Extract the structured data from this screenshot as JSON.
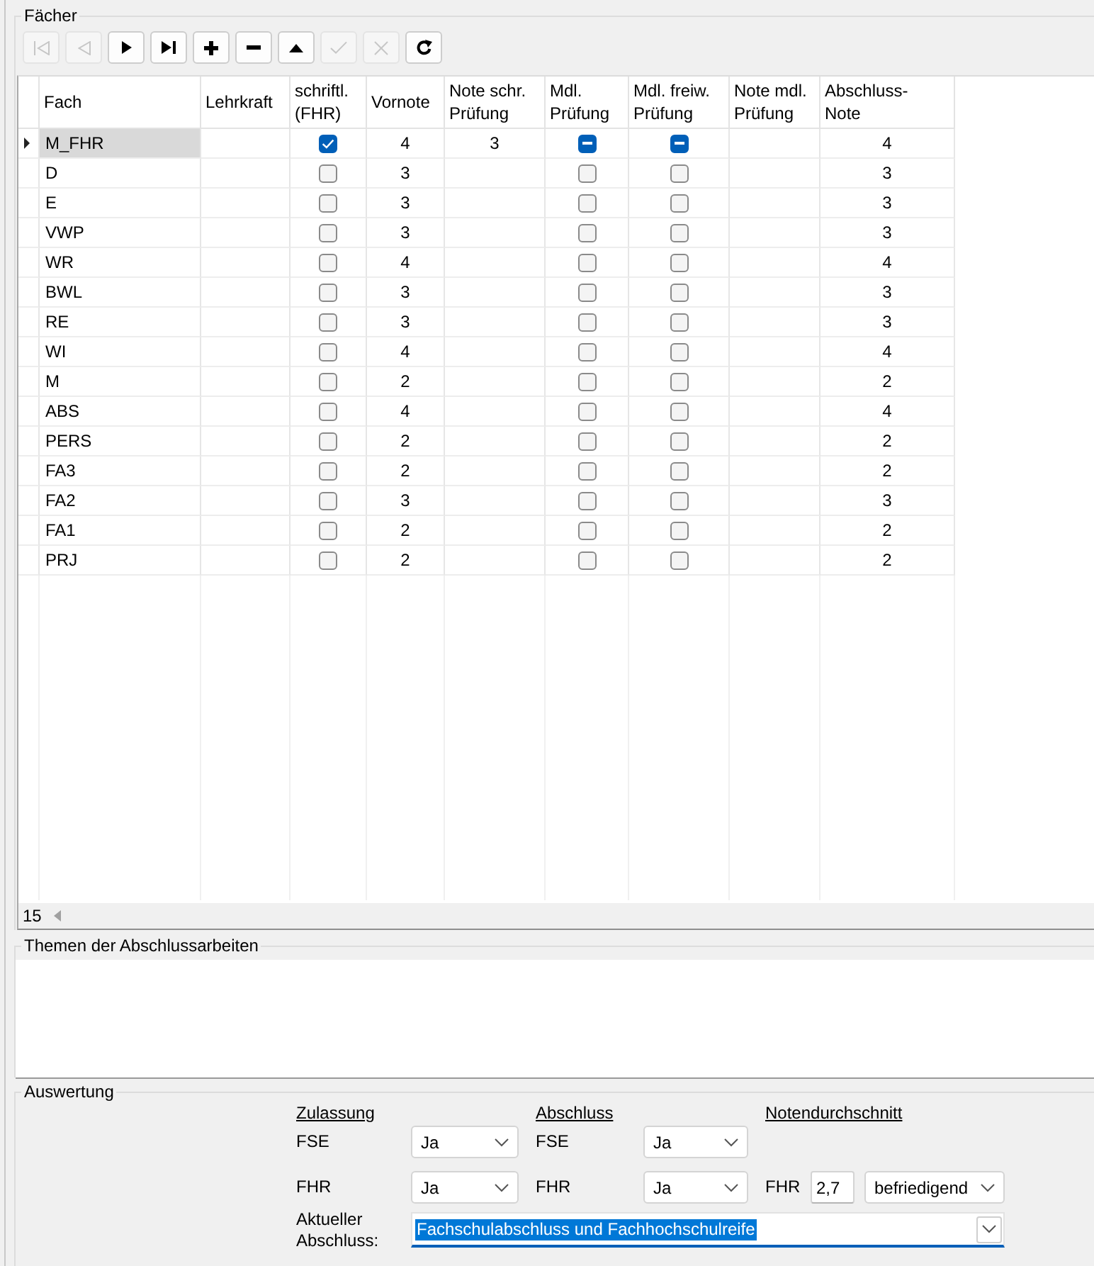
{
  "subjects": {
    "title": "Fächer",
    "toolbar": [
      {
        "kind": "first",
        "disabled": true
      },
      {
        "kind": "prior",
        "disabled": true
      },
      {
        "kind": "next",
        "disabled": false
      },
      {
        "kind": "last",
        "disabled": false
      },
      {
        "kind": "insert",
        "disabled": false
      },
      {
        "kind": "delete",
        "disabled": false
      },
      {
        "kind": "edit",
        "disabled": false
      },
      {
        "kind": "post",
        "disabled": true
      },
      {
        "kind": "cancel",
        "disabled": true
      },
      {
        "kind": "refresh",
        "disabled": false
      }
    ],
    "table": {
      "columns": [
        "Fach",
        "Lehrkraft",
        "schriftl. (FHR)",
        "Vornote",
        "Note schr. Prüfung",
        "Mdl. Prüfung",
        "Mdl. freiw. Prüfung",
        "Note mdl. Prüfung",
        "Abschluss-Note"
      ],
      "rows": [
        {
          "selected": true,
          "fach": "M_FHR",
          "schriftl": {
            "checked": true
          },
          "vornote": "4",
          "note_schr": "3",
          "mdl": {
            "checked": true,
            "indeterminate": true
          },
          "mdl_freiw": {
            "checked": true,
            "indeterminate": true
          },
          "abschluss_note": "4"
        },
        {
          "selected": false,
          "fach": "D",
          "schriftl": {
            "checked": false
          },
          "vornote": "3",
          "mdl": {
            "checked": false
          },
          "mdl_freiw": {
            "checked": false
          },
          "abschluss_note": "3"
        },
        {
          "selected": false,
          "fach": "E",
          "schriftl": {
            "checked": false
          },
          "vornote": "3",
          "mdl": {
            "checked": false
          },
          "mdl_freiw": {
            "checked": false
          },
          "abschluss_note": "3"
        },
        {
          "selected": false,
          "fach": "VWP",
          "schriftl": {
            "checked": false
          },
          "vornote": "3",
          "mdl": {
            "checked": false
          },
          "mdl_freiw": {
            "checked": false
          },
          "abschluss_note": "3"
        },
        {
          "selected": false,
          "fach": "WR",
          "schriftl": {
            "checked": false
          },
          "vornote": "4",
          "mdl": {
            "checked": false
          },
          "mdl_freiw": {
            "checked": false
          },
          "abschluss_note": "4"
        },
        {
          "selected": false,
          "fach": "BWL",
          "schriftl": {
            "checked": false
          },
          "vornote": "3",
          "mdl": {
            "checked": false
          },
          "mdl_freiw": {
            "checked": false
          },
          "abschluss_note": "3"
        },
        {
          "selected": false,
          "fach": "RE",
          "schriftl": {
            "checked": false
          },
          "vornote": "3",
          "mdl": {
            "checked": false
          },
          "mdl_freiw": {
            "checked": false
          },
          "abschluss_note": "3"
        },
        {
          "selected": false,
          "fach": "WI",
          "schriftl": {
            "checked": false
          },
          "vornote": "4",
          "mdl": {
            "checked": false
          },
          "mdl_freiw": {
            "checked": false
          },
          "abschluss_note": "4"
        },
        {
          "selected": false,
          "fach": "M",
          "schriftl": {
            "checked": false
          },
          "vornote": "2",
          "mdl": {
            "checked": false
          },
          "mdl_freiw": {
            "checked": false
          },
          "abschluss_note": "2"
        },
        {
          "selected": false,
          "fach": "ABS",
          "schriftl": {
            "checked": false
          },
          "vornote": "4",
          "mdl": {
            "checked": false
          },
          "mdl_freiw": {
            "checked": false
          },
          "abschluss_note": "4"
        },
        {
          "selected": false,
          "fach": "PERS",
          "schriftl": {
            "checked": false
          },
          "vornote": "2",
          "mdl": {
            "checked": false
          },
          "mdl_freiw": {
            "checked": false
          },
          "abschluss_note": "2"
        },
        {
          "selected": false,
          "fach": "FA3",
          "schriftl": {
            "checked": false
          },
          "vornote": "2",
          "mdl": {
            "checked": false
          },
          "mdl_freiw": {
            "checked": false
          },
          "abschluss_note": "2"
        },
        {
          "selected": false,
          "fach": "FA2",
          "schriftl": {
            "checked": false
          },
          "vornote": "3",
          "mdl": {
            "checked": false
          },
          "mdl_freiw": {
            "checked": false
          },
          "abschluss_note": "3"
        },
        {
          "selected": false,
          "fach": "FA1",
          "schriftl": {
            "checked": false
          },
          "vornote": "2",
          "mdl": {
            "checked": false
          },
          "mdl_freiw": {
            "checked": false
          },
          "abschluss_note": "2"
        },
        {
          "selected": false,
          "fach": "PRJ",
          "schriftl": {
            "checked": false
          },
          "vornote": "2",
          "mdl": {
            "checked": false
          },
          "mdl_freiw": {
            "checked": false
          },
          "abschluss_note": "2"
        }
      ],
      "record_count": "15"
    }
  },
  "topics": {
    "title": "Themen der Abschlussarbeiten"
  },
  "evaluation": {
    "title": "Auswertung",
    "sections": [
      {
        "heading": "Zulassung",
        "fields": [
          {
            "label": "FSE",
            "value": "Ja"
          },
          {
            "label": "FHR",
            "value": "Ja"
          }
        ]
      },
      {
        "heading": "Abschluss",
        "fields": [
          {
            "label": "FSE",
            "value": "Ja"
          },
          {
            "label": "FHR",
            "value": "Ja"
          }
        ]
      },
      {
        "heading": "Notendurchschnitt",
        "fields": [
          {
            "label": "FHR",
            "value": "2,7",
            "grade": "befriedigend"
          }
        ]
      }
    ],
    "current": {
      "label": "Aktueller Abschluss:",
      "value": "Fachschulabschluss und Fachhochschulreife",
      "selected": true
    }
  }
}
